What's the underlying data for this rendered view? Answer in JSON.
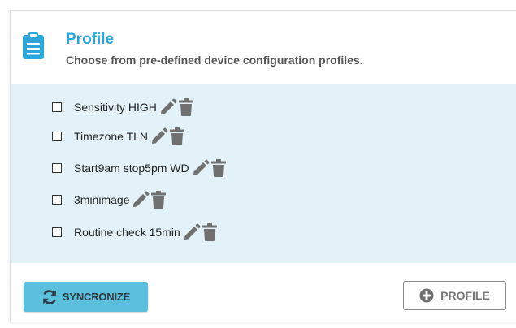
{
  "profile": {
    "title": "Profile",
    "subtitle": "Choose from pre-defined device configuration profiles.",
    "icon": "clipboard-icon",
    "items": [
      {
        "label": "Sensitivity HIGH",
        "checked": false
      },
      {
        "label": "Timezone TLN",
        "checked": false
      },
      {
        "label": "Start9am stop5pm WD",
        "checked": false
      },
      {
        "label": "3minimage",
        "checked": false
      },
      {
        "label": "Routine check 15min",
        "checked": false
      }
    ]
  },
  "buttons": {
    "sync_label": "SYNCRONIZE",
    "sync_icon": "refresh-icon",
    "add_profile_label": "PROFILE",
    "add_profile_icon": "plus-circle-icon"
  },
  "colors": {
    "accent": "#2ba7db",
    "list_background": "#e3f2f8",
    "sync_button": "#5bc0de",
    "icon_gray": "#707070"
  }
}
